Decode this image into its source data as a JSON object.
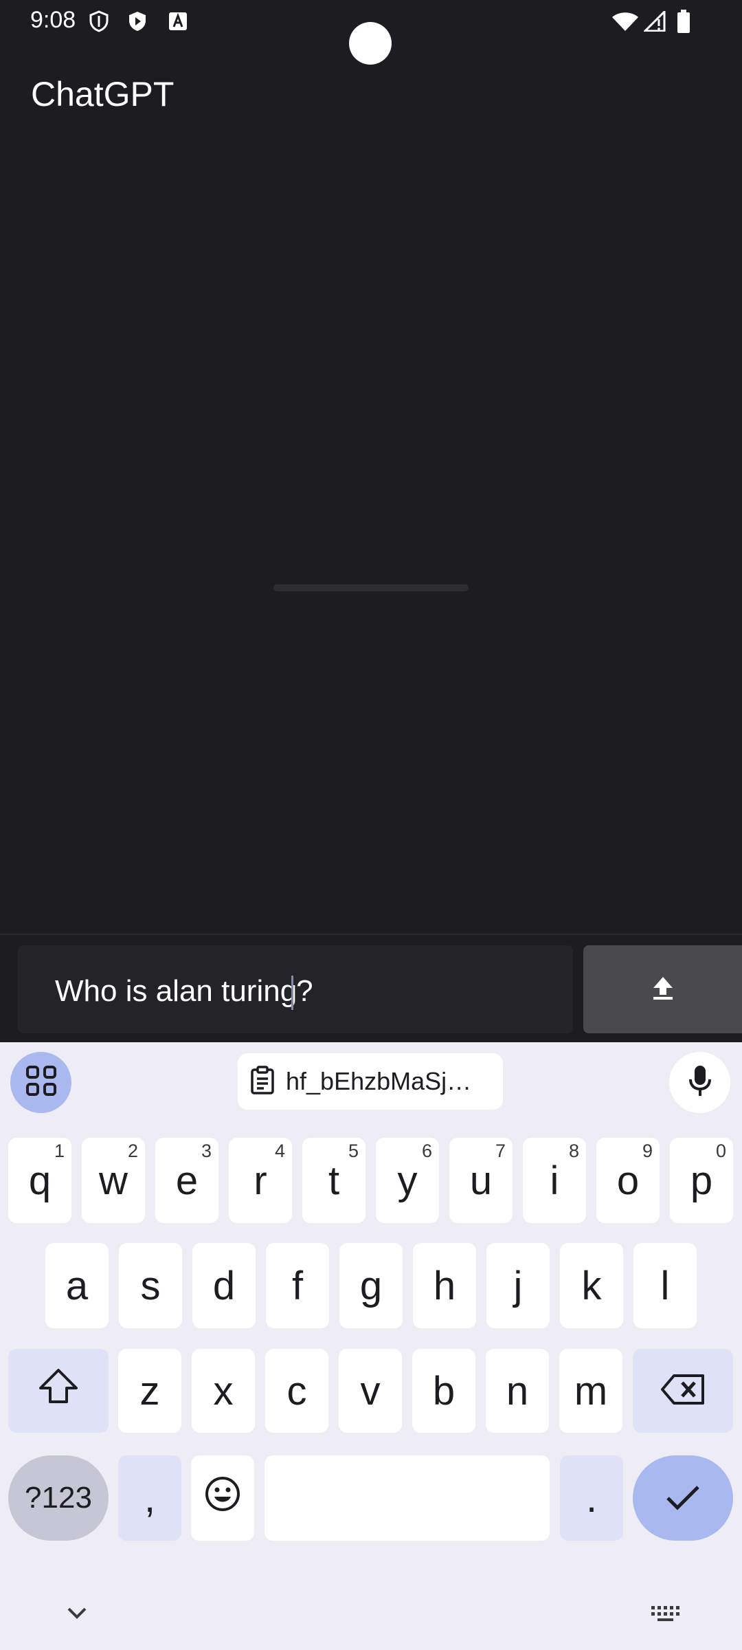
{
  "status_bar": {
    "time": "9:08",
    "icons": [
      "shield-icon",
      "play-shield-icon",
      "font-a-icon",
      "wifi-icon",
      "signal-icon",
      "battery-icon"
    ]
  },
  "app": {
    "title": "ChatGPT"
  },
  "composer": {
    "input_value_before_caret": "Who is alan turing",
    "input_value_after_caret": "?",
    "send_icon": "upload-arrow-icon"
  },
  "keyboard": {
    "clipboard_chip": "hf_bEhzbMaSj…",
    "row1": [
      {
        "k": "q",
        "h": "1"
      },
      {
        "k": "w",
        "h": "2"
      },
      {
        "k": "e",
        "h": "3"
      },
      {
        "k": "r",
        "h": "4"
      },
      {
        "k": "t",
        "h": "5"
      },
      {
        "k": "y",
        "h": "6"
      },
      {
        "k": "u",
        "h": "7"
      },
      {
        "k": "i",
        "h": "8"
      },
      {
        "k": "o",
        "h": "9"
      },
      {
        "k": "p",
        "h": "0"
      }
    ],
    "row2": [
      "a",
      "s",
      "d",
      "f",
      "g",
      "h",
      "j",
      "k",
      "l"
    ],
    "row3": [
      "z",
      "x",
      "c",
      "v",
      "b",
      "n",
      "m"
    ],
    "symbols_label": "?123",
    "comma": ",",
    "period": ".",
    "colors": {
      "accent": "#a9b8ef",
      "func": "#dfe2f6",
      "bg": "#eeedf5"
    }
  }
}
